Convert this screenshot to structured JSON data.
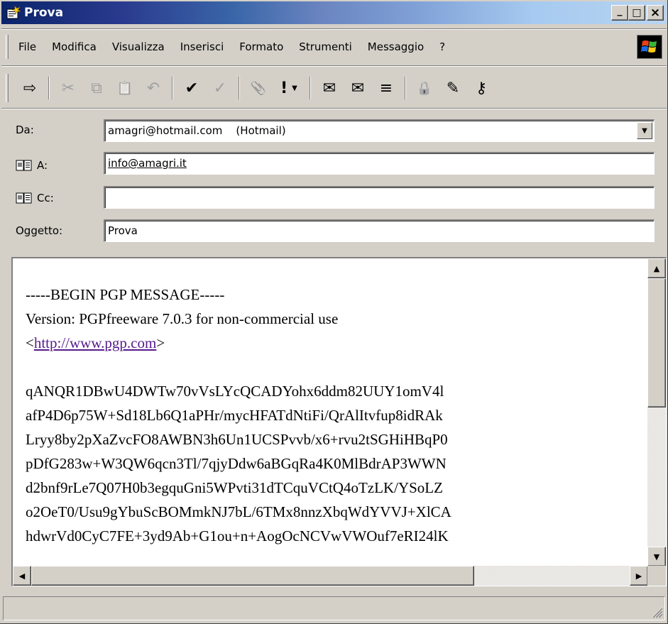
{
  "window": {
    "title": "Prova",
    "minimize_glyph": "_",
    "maximize_glyph": "□",
    "close_glyph": "×"
  },
  "menu": {
    "items": [
      "File",
      "Modifica",
      "Visualizza",
      "Inserisci",
      "Formato",
      "Strumenti",
      "Messaggio",
      "?"
    ]
  },
  "toolbar": {
    "tools": [
      {
        "name": "send-icon",
        "glyph": "⇨",
        "enabled": true
      },
      {
        "name": "cut-icon",
        "glyph": "✂",
        "enabled": false
      },
      {
        "name": "copy-icon",
        "glyph": "⧉",
        "enabled": false
      },
      {
        "name": "paste-icon",
        "glyph": "📋",
        "enabled": false
      },
      {
        "name": "undo-icon",
        "glyph": "↶",
        "enabled": false
      },
      {
        "name": "check-names-icon",
        "glyph": "✔",
        "enabled": true
      },
      {
        "name": "spelling-icon",
        "glyph": "✓",
        "enabled": false
      },
      {
        "name": "attach-icon",
        "glyph": "📎",
        "enabled": true
      },
      {
        "name": "priority-icon",
        "glyph": "!",
        "enabled": true
      },
      {
        "name": "sign-icon",
        "glyph": "✉",
        "enabled": true
      },
      {
        "name": "encrypt-icon",
        "glyph": "✉",
        "enabled": true
      },
      {
        "name": "offline-icon",
        "glyph": "≡",
        "enabled": true
      },
      {
        "name": "pgp-encrypt-icon",
        "glyph": "🔒",
        "enabled": true
      },
      {
        "name": "pgp-sign-icon",
        "glyph": "✎",
        "enabled": true
      },
      {
        "name": "pgp-keys-icon",
        "glyph": "⚷",
        "enabled": true
      }
    ]
  },
  "header": {
    "from_label": "Da:",
    "from_value": "amagri@hotmail.com    (Hotmail)",
    "to_label": "A:",
    "to_value": "info@amagri.it",
    "cc_label": "Cc:",
    "cc_value": "",
    "subject_label": "Oggetto:",
    "subject_value": "Prova"
  },
  "body": {
    "line1": "-----BEGIN PGP MESSAGE-----",
    "line2": "Version: PGPfreeware 7.0.3 for non-commercial use",
    "link_open": "<",
    "link_text": "http://www.pgp.com",
    "link_close": ">",
    "cipher_lines": [
      "qANQR1DBwU4DWTw70vVsLYcQCADYohx6ddm82UUY1omV4l",
      "afP4D6p75W+Sd18Lb6Q1aPHr/mycHFATdNtiFi/QrAlItvfup8idRAk",
      "Lryy8by2pXaZvcFO8AWBN3h6Un1UCSPvvb/x6+rvu2tSGHiHBqP0",
      "pDfG283w+W3QW6qcn3Tl/7qjyDdw6aBGqRa4K0MlBdrAP3WWN",
      "d2bnf9rLe7Q07H0b3egquGni5WPvti31dTCquVCtQ4oTzLK/YSoLZ",
      "o2OeT0/Usu9gYbuScBOMmkNJ7bL/6TMx8nnzXbqWdYVVJ+XlCA",
      "hdwrVd0CyC7FE+3yd9Ab+G1ou+n+AogOcNCVwVWOuf7eRI24lK"
    ]
  }
}
